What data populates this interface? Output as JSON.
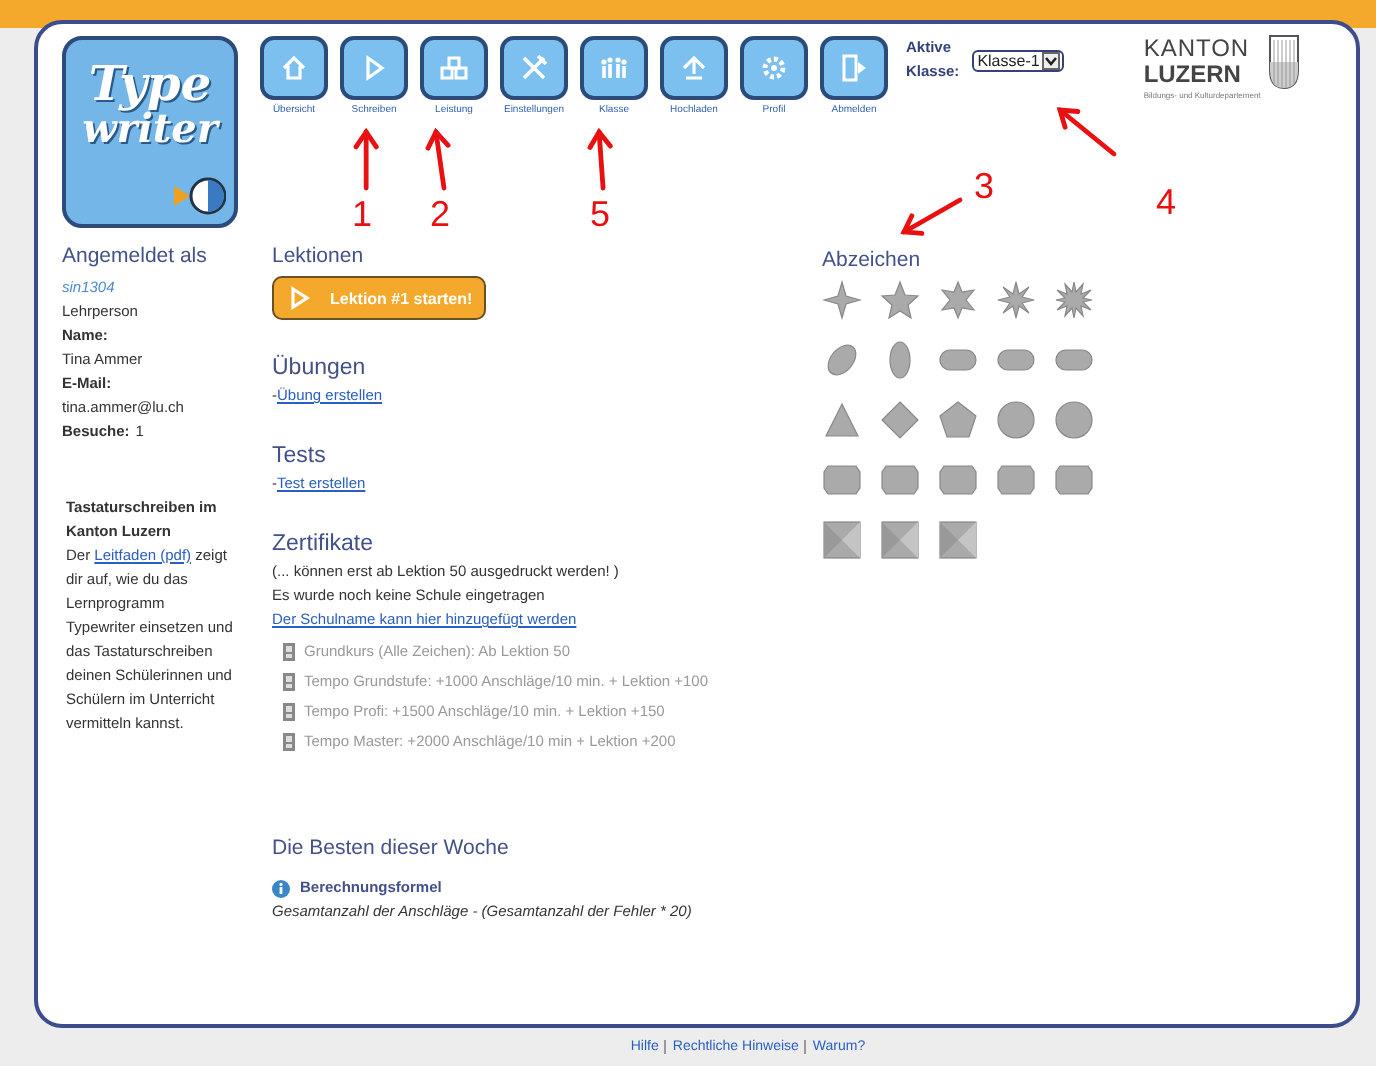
{
  "logo": {
    "line1": "Type",
    "line2": "writer"
  },
  "nav": [
    {
      "label": "Übersicht"
    },
    {
      "label": "Schreiben"
    },
    {
      "label": "Leistung"
    },
    {
      "label": "Einstellungen"
    },
    {
      "label": "Klasse"
    },
    {
      "label": "Hochladen"
    },
    {
      "label": "Profil"
    },
    {
      "label": "Abmelden"
    }
  ],
  "class_select": {
    "label_line1": "Aktive",
    "label_line2": "Klasse:",
    "value": "Klasse-1"
  },
  "canton_logo": {
    "line1": "KANTON",
    "line2": "LUZERN",
    "subtitle": "Bildungs- und Kulturdepartement"
  },
  "user": {
    "heading": "Angemeldet als",
    "username": "sin1304",
    "role": "Lehrperson",
    "name_label": "Name:",
    "name": "Tina Ammer",
    "email_label": "E-Mail:",
    "email": "tina.ammer@lu.ch",
    "visits_label": "Besuche:",
    "visits": "1"
  },
  "info": {
    "title": "Tastaturschreiben im Kanton Luzern",
    "before": "Der ",
    "link": "Leitfaden (pdf)",
    "after": " zeigt dir auf, wie du das Lernprogramm Typewriter einsetzen und das Tastaturschreiben deinen Schülerinnen und Schülern im Unterricht vermitteln kannst."
  },
  "lessons": {
    "heading": "Lektionen",
    "button": "Lektion #1 starten!"
  },
  "exercises": {
    "heading": "Übungen",
    "prefix": "-",
    "link": "Übung erstellen"
  },
  "tests": {
    "heading": "Tests",
    "prefix": "-",
    "link": "Test erstellen"
  },
  "certificates": {
    "heading": "Zertifikate",
    "note": "(... können erst ab Lektion 50 ausgedruckt werden! )",
    "no_school": "Es wurde noch keine Schule eingetragen",
    "link": "Der Schulname kann hier hinzugefügt werden",
    "items": [
      {
        "text": "Grundkurs (Alle Zeichen): Ab Lektion 50",
        "disabled": true
      },
      {
        "text": "Tempo Grundstufe: +1000 Anschläge/10 min. + Lektion +100",
        "disabled": true
      },
      {
        "text": "Tempo Profi: +1500 Anschläge/10 min. + Lektion +150",
        "disabled": true
      },
      {
        "text": "Tempo Master: +2000 Anschläge/10 min + Lektion +200",
        "disabled": true
      }
    ]
  },
  "badges": {
    "heading": "Abzeichen"
  },
  "best": {
    "heading": "Die Besten dieser Woche",
    "formula_title": "Berechnungsformel",
    "formula": "Gesamtanzahl der Anschläge - (Gesamtanzahl der Fehler * 20)"
  },
  "footer": [
    "Hilfe",
    "Rechtliche Hinweise",
    "Warum?"
  ],
  "annotations": [
    {
      "label": "1"
    },
    {
      "label": "2"
    },
    {
      "label": "5"
    },
    {
      "label": "3"
    },
    {
      "label": "4"
    }
  ]
}
